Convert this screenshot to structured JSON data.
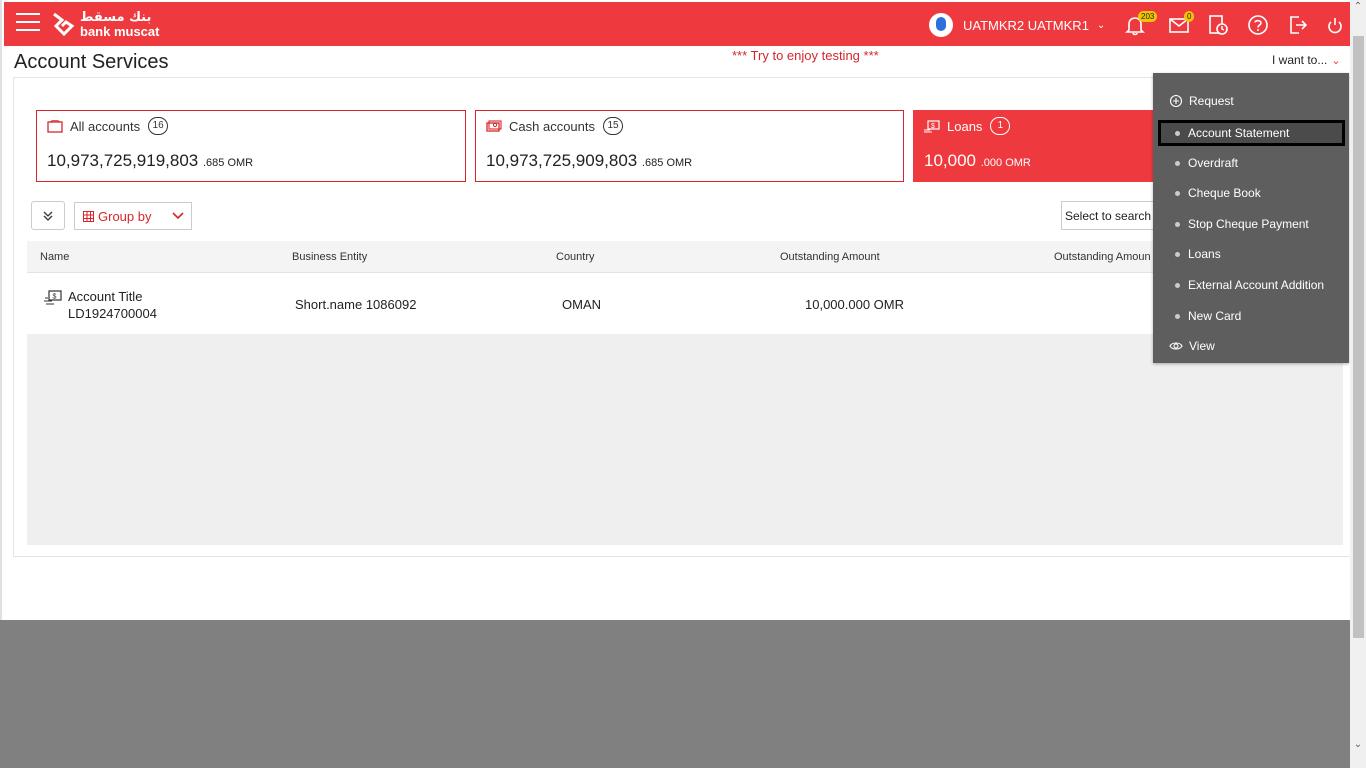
{
  "header": {
    "logo_arabic": "بنك مسقط",
    "logo_english": "bank muscat",
    "user_name": "UATMKR2 UATMKR1",
    "notifications_count": "203",
    "messages_count": "0"
  },
  "page": {
    "title": "Account Services",
    "banner": "*** Try to enjoy testing ***",
    "i_want_to": "I want to..."
  },
  "summary_cards": [
    {
      "label": "All accounts",
      "count": "16",
      "amount_main": "10,973,725,919,803",
      "amount_decimal": ".685 OMR",
      "active": false
    },
    {
      "label": "Cash accounts",
      "count": "15",
      "amount_main": "10,973,725,909,803",
      "amount_decimal": ".685 OMR",
      "active": false
    },
    {
      "label": "Loans",
      "count": "1",
      "amount_main": "10,000",
      "amount_decimal": ".000 OMR",
      "active": true
    }
  ],
  "toolbar": {
    "group_by": "Group by",
    "search_placeholder": "Select to search"
  },
  "table": {
    "columns": [
      "Name",
      "Business Entity",
      "Country",
      "Outstanding Amount",
      "Outstanding Amoun"
    ],
    "rows": [
      {
        "name_title": "Account Title",
        "name_id": "LD1924700004",
        "business_entity": "Short.name 1086092",
        "country": "OMAN",
        "outstanding_amount": "10,000.000 OMR"
      }
    ]
  },
  "menu": {
    "request_label": "Request",
    "items": [
      "Account Statement",
      "Overdraft",
      "Cheque Book",
      "Stop Cheque Payment",
      "Loans",
      "External Account Addition",
      "New Card"
    ],
    "selected_index": 0,
    "view_label": "View"
  },
  "colors": {
    "brand_red": "#ee3a3f",
    "menu_bg": "#5e5e5e",
    "badge_yellow": "#f3c400"
  }
}
